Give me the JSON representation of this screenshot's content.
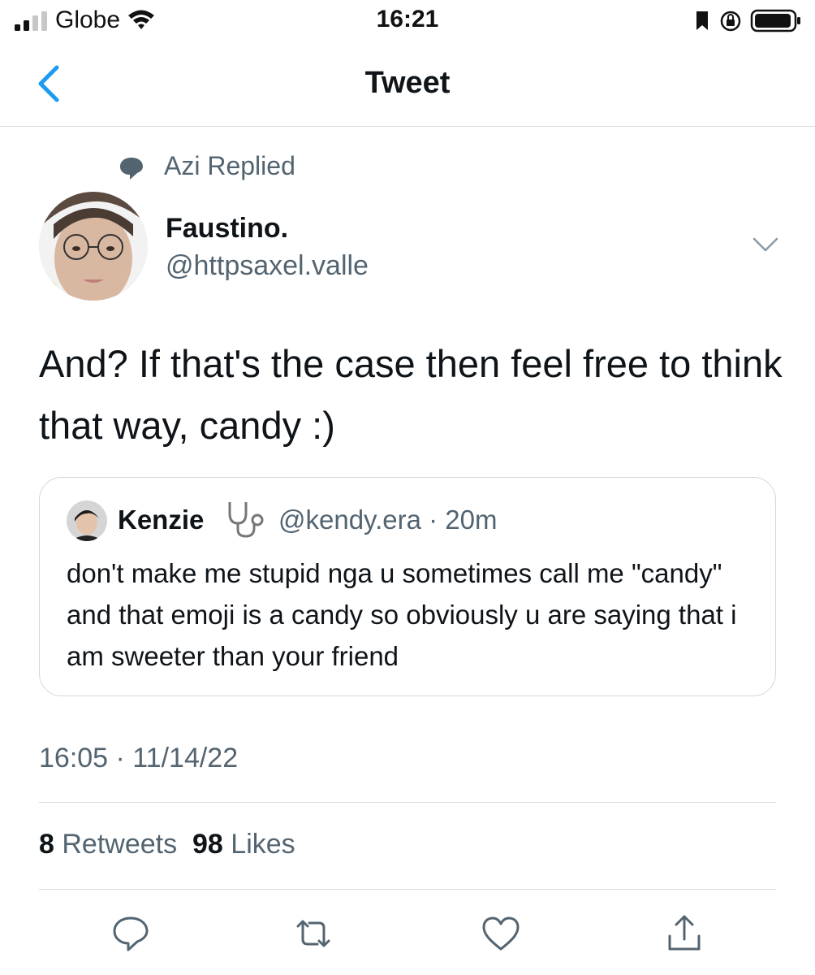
{
  "status_bar": {
    "carrier": "Globe",
    "time": "16:21",
    "icons": [
      "signal-icon",
      "wifi-icon",
      "bookmark-icon",
      "orientation-lock-icon",
      "battery-icon"
    ]
  },
  "nav": {
    "title": "Tweet",
    "back_icon": "chevron-left-icon"
  },
  "tweet": {
    "context": "Azi Replied",
    "context_icon": "speech-bubble-icon",
    "author": {
      "display_name": "Faustino.",
      "handle": "@httpsaxel.valle"
    },
    "text": "And? If that's the case then feel free to think that way, candy :)",
    "quoted": {
      "display_name": "Kenzie",
      "name_emoji": "stethoscope-emoji",
      "handle_meta": "@kendy.era · 20m",
      "text": "don't make me stupid nga u sometimes call me \"candy\" and that emoji is a candy so obviously u are saying that i am sweeter than your friend"
    },
    "timestamp": "16:05 · 11/14/22",
    "retweets_count": "8",
    "retweets_label": "Retweets",
    "likes_count": "98",
    "likes_label": "Likes"
  },
  "actions": [
    "reply-icon",
    "retweet-icon",
    "like-icon",
    "share-icon"
  ],
  "colors": {
    "accent": "#1d9bf0",
    "secondary_text": "#536471",
    "divider": "#d6d9db"
  }
}
